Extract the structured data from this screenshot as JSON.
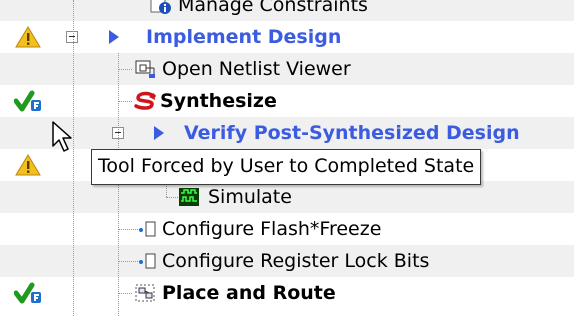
{
  "tree": {
    "rows": [
      {
        "label": "Manage Constraints"
      },
      {
        "label": "Implement Design"
      },
      {
        "label": "Open Netlist Viewer"
      },
      {
        "label": "Synthesize"
      },
      {
        "label": "Verify Post-Synthesized Design"
      },
      {
        "label": ""
      },
      {
        "label": "Simulate"
      },
      {
        "label": "Configure Flash*Freeze"
      },
      {
        "label": "Configure Register Lock Bits"
      },
      {
        "label": "Place and Route"
      }
    ]
  },
  "tooltip": {
    "text": "Tool Forced by User to Completed State"
  },
  "icons": {
    "warning": "warning-icon",
    "forced_complete": "forced-complete-check-icon",
    "tool_arrow": "play-arrow-icon",
    "netlist": "netlist-viewer-icon",
    "synthesize": "synthesize-icon",
    "simulate": "waveform-icon",
    "configure": "configure-icon",
    "place_route": "place-and-route-icon"
  },
  "colors": {
    "link_text": "#3b5be0",
    "alt_row": "#f0f0f0",
    "warning_fill": "#f2c01e",
    "check_green": "#1f9a1f",
    "synth_red": "#d0141c"
  }
}
